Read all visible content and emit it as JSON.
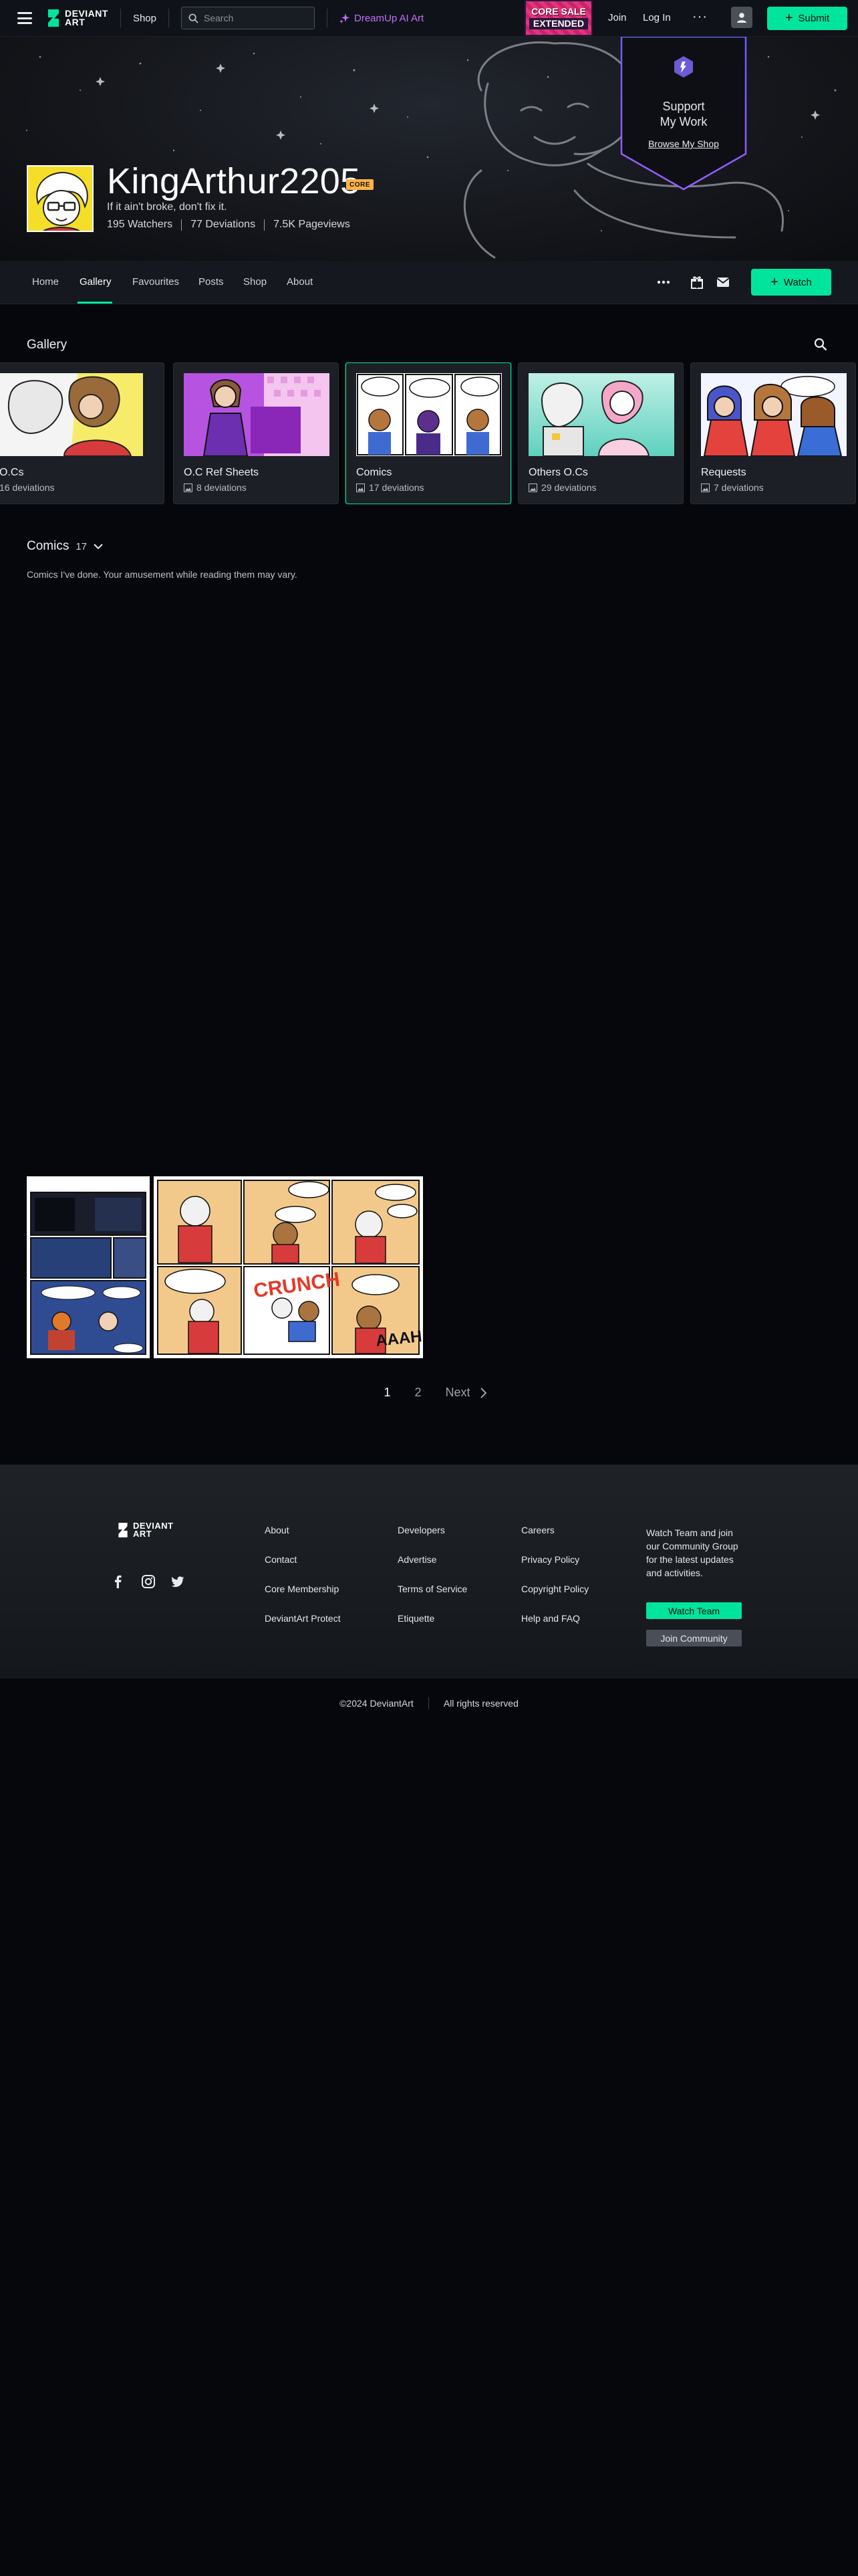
{
  "topbar": {
    "logo_text_line1": "DEVIANT",
    "logo_text_line2": "ART",
    "shop": "Shop",
    "search_placeholder": "Search",
    "dreamup": "DreamUp AI Art",
    "promo_line1": "CORE SALE",
    "promo_line2": "EXTENDED",
    "join": "Join",
    "login": "Log In",
    "more": "···",
    "submit": "Submit"
  },
  "profile": {
    "username": "KingArthur2205",
    "badge": "CORE",
    "tagline": "If it ain't broke, don't fix it.",
    "watchers": "195 Watchers",
    "deviations": "77 Deviations",
    "pageviews": "7.5K Pageviews",
    "support_title_line1": "Support",
    "support_title_line2": "My Work",
    "support_link": "Browse My Shop"
  },
  "nav": {
    "tabs": [
      "Home",
      "Gallery",
      "Favourites",
      "Posts",
      "Shop",
      "About"
    ],
    "active_tab": "Gallery",
    "watch": "Watch"
  },
  "gallery": {
    "title": "Gallery",
    "folders": [
      {
        "name": "O.Cs",
        "count": "16 deviations"
      },
      {
        "name": "O.C Ref Sheets",
        "count": "8 deviations"
      },
      {
        "name": "Comics",
        "count": "17 deviations"
      },
      {
        "name": "Others O.Cs",
        "count": "29 deviations"
      },
      {
        "name": "Requests",
        "count": "7 deviations"
      }
    ],
    "selected_folder": "Comics",
    "section_title": "Comics",
    "section_count": "17",
    "section_description": "Comics I've done. Your amusement while reading them may vary.",
    "pagination": {
      "pages": [
        "1",
        "2"
      ],
      "current": "1",
      "next": "Next"
    }
  },
  "footer": {
    "logo_text_line1": "DEVIANT",
    "logo_text_line2": "ART",
    "col1": [
      "About",
      "Contact",
      "Core Membership",
      "DeviantArt Protect"
    ],
    "col2": [
      "Developers",
      "Advertise",
      "Terms of Service",
      "Etiquette"
    ],
    "col3": [
      "Careers",
      "Privacy Policy",
      "Copyright Policy",
      "Help and FAQ"
    ],
    "watch_text": "Watch Team and join our Community Group for the latest updates and activities.",
    "watch_team": "Watch Team",
    "join_community": "Join Community",
    "copyright": "©2024 DeviantArt",
    "rights": "All rights reserved"
  },
  "colors": {
    "accent": "#00e59b",
    "background": "#06070d",
    "dreamup": "#c36cff",
    "core_badge": "#ffb347"
  },
  "icons": [
    "menu-icon",
    "search-icon",
    "dreamup-icon",
    "user-icon",
    "more-icon",
    "gift-icon",
    "mail-icon",
    "image-icon",
    "lock-icon",
    "chevron-down-icon",
    "chevron-right-icon",
    "facebook-icon",
    "instagram-icon",
    "twitter-icon",
    "core-points-icon"
  ]
}
